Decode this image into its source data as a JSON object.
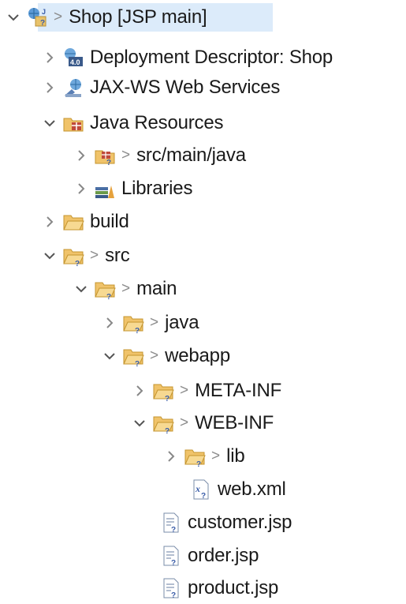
{
  "tree": {
    "items": [
      {
        "label": "Shop [JSP main]",
        "decorator": ">",
        "expanded": true,
        "icon": "project-icon"
      },
      {
        "label": "Deployment Descriptor: Shop",
        "expanded": false,
        "icon": "deployment-descriptor-icon"
      },
      {
        "label": "JAX-WS Web Services",
        "expanded": false,
        "icon": "web-services-icon"
      },
      {
        "label": "Java Resources",
        "expanded": true,
        "icon": "java-resources-icon"
      },
      {
        "label": "src/main/java",
        "decorator": ">",
        "expanded": false,
        "icon": "source-folder-icon"
      },
      {
        "label": "Libraries",
        "expanded": false,
        "icon": "libraries-icon"
      },
      {
        "label": "build",
        "expanded": false,
        "icon": "folder-icon"
      },
      {
        "label": "src",
        "decorator": ">",
        "expanded": true,
        "icon": "folder-icon"
      },
      {
        "label": "main",
        "decorator": ">",
        "expanded": true,
        "icon": "folder-icon"
      },
      {
        "label": "java",
        "decorator": ">",
        "expanded": false,
        "icon": "folder-icon"
      },
      {
        "label": "webapp",
        "decorator": ">",
        "expanded": true,
        "icon": "folder-icon"
      },
      {
        "label": "META-INF",
        "decorator": ">",
        "expanded": false,
        "icon": "folder-icon"
      },
      {
        "label": "WEB-INF",
        "decorator": ">",
        "expanded": true,
        "icon": "folder-icon"
      },
      {
        "label": "lib",
        "decorator": ">",
        "expanded": false,
        "icon": "folder-icon"
      },
      {
        "label": "web.xml",
        "icon": "xml-file-icon"
      },
      {
        "label": "customer.jsp",
        "icon": "jsp-file-icon"
      },
      {
        "label": "order.jsp",
        "icon": "jsp-file-icon"
      },
      {
        "label": "product.jsp",
        "icon": "jsp-file-icon"
      }
    ]
  }
}
